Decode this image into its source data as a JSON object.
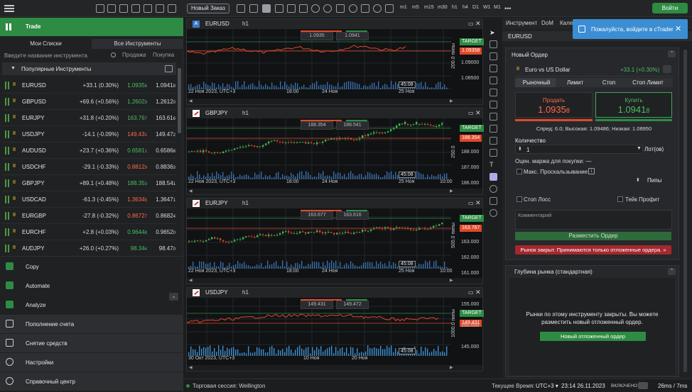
{
  "topbar": {
    "new_order_label": "Новый Заказ",
    "timeframes": [
      "m1",
      "m5",
      "m15",
      "m30",
      "h1",
      "h4",
      "D1",
      "W1",
      "M1"
    ],
    "login_label": "Войти"
  },
  "left": {
    "trade_title": "Trade",
    "tabs": [
      "Мои Списки",
      "Все Инструменты"
    ],
    "search_placeholder": "Введите название инструмента",
    "col_sell": "Продажа",
    "col_buy": "Покупка",
    "popular_title": "Популярные Инструменты",
    "instruments": [
      {
        "sym": "EURUSD",
        "chg": "+33.1 (0.30%)",
        "sell": "1.0935",
        "sell_sup": "8",
        "buy": "1.0941",
        "buy_sup": "8"
      },
      {
        "sym": "GBPUSD",
        "chg": "+69.6 (+0.56%)",
        "sell": "1.2602",
        "sell_sup": "9",
        "buy": "1.2612",
        "buy_sup": "0"
      },
      {
        "sym": "EURJPY",
        "chg": "+31.8 (+0.20%)",
        "sell": "163.76",
        "sell_sup": "7",
        "buy": "163.61",
        "buy_sup": "6"
      },
      {
        "sym": "USDJPY",
        "chg": "-14.1 (-0.09%)",
        "sell": "149.43",
        "sell_sup": "1",
        "buy": "149.47",
        "buy_sup": "2"
      },
      {
        "sym": "AUDUSD",
        "chg": "+23.7 (+0.36%)",
        "sell": "0.6581",
        "sell_sup": "1",
        "buy": "0.6586",
        "buy_sup": "8"
      },
      {
        "sym": "USDCHF",
        "chg": "-29.1 (-0.33%)",
        "sell": "0.8812",
        "sell_sup": "9",
        "buy": "0.8836",
        "buy_sup": "3"
      },
      {
        "sym": "GBPJPY",
        "chg": "+89.1 (+0.48%)",
        "sell": "188.35",
        "sell_sup": "3",
        "buy": "188.54",
        "buy_sup": "1"
      },
      {
        "sym": "USDCAD",
        "chg": "-61.3 (-0.45%)",
        "sell": "1.3634",
        "sell_sup": "5",
        "buy": "1.3647",
        "buy_sup": "1"
      },
      {
        "sym": "EURGBP",
        "chg": "-27.8 (-0.32%)",
        "sell": "0.8672",
        "sell_sup": "7",
        "buy": "0.8682",
        "buy_sup": "4"
      },
      {
        "sym": "EURCHF",
        "chg": "+2.8 (+0.03%)",
        "sell": "0.9644",
        "sell_sup": "8",
        "buy": "0.9652",
        "buy_sup": "0"
      },
      {
        "sym": "AUDJPY",
        "chg": "+26.0 (+0.27%)",
        "sell": "98.34",
        "sell_sup": "4",
        "buy": "98.47",
        "buy_sup": "0"
      }
    ],
    "menu": [
      "Copy",
      "Automate",
      "Analyze",
      "Пополнение счета",
      "Снятие средств",
      "Настройки",
      "Справочный центр"
    ]
  },
  "charts": [
    {
      "sym": "EURUSD",
      "tf": "h1",
      "target": "TARGET",
      "price": "1.09358",
      "y_labels": [
        "1.09000",
        "1.08500"
      ],
      "x_labels": [
        "22 Ноя 2023, UTC+3",
        "18:00",
        "24 Ноя",
        "25 Ноя"
      ],
      "time_box": "45:08",
      "pips_label": "200.0 пипы",
      "bid": "1.0935",
      "ask": "1.0941"
    },
    {
      "sym": "GBPJPY",
      "tf": "h1",
      "target": "TARGET",
      "price": "188.354",
      "y_labels": [
        "188.000",
        "187.000",
        "186.000"
      ],
      "x_labels": [
        "22 Ноя 2023, UTC+3",
        "18:00",
        "24 Ноя",
        "25 Ноя",
        "10:00"
      ],
      "time_box": "45:08",
      "pips_label": "250.0",
      "bid": "188.354",
      "ask": "188.541"
    },
    {
      "sym": "EURJPY",
      "tf": "h1",
      "target": "TARGET",
      "price": "163.767",
      "y_labels": [
        "163.000",
        "162.000",
        "161.000"
      ],
      "x_labels": [
        "22 Ноя 2023, UTC+3",
        "18:00",
        "24 Ноя",
        "25 Ноя",
        "10:00"
      ],
      "time_box": "45:08",
      "pips_label": "500.0 пипы",
      "bid": "163.677",
      "ask": "163.616"
    },
    {
      "sym": "USDJPY",
      "tf": "h1",
      "target": "TARGET",
      "price": "149.431",
      "y_labels": [
        "155.000",
        "150.000",
        "145.000"
      ],
      "x_labels": [
        "30 Окт 2023, UTC+3",
        "10 Ноя",
        "20 Ноя"
      ],
      "time_box": "45:08",
      "pips_label": "1000.0 пипы",
      "bid": "149.431",
      "ask": "149.472"
    }
  ],
  "right": {
    "tabs": [
      "Инструмент",
      "DoM",
      "Кале"
    ],
    "symbol": "EURUSD",
    "login_notice": "Пожалуйста, войдите в cTrader",
    "order_title": "Новый Ордер",
    "inst_name": "Euro vs US Dollar",
    "inst_chg": "+33.1 (+0.30%)",
    "order_types": [
      "Рыночный",
      "Лимит",
      "Стоп",
      "Стоп Лимит"
    ],
    "sell_label": "Продать",
    "sell_price": "1.0935",
    "sell_sup": "8",
    "buy_label": "Купить",
    "buy_price": "1.0941",
    "buy_sup": "8",
    "spread": "Спред: 6.0; Высокая: 1.09486; Низкая: 1.08950",
    "qty_label": "Количество",
    "qty_value": "1",
    "lots_label": "Лот(ов)",
    "margin_label": "Оцен. маржа для покупки: —",
    "slippage_label": "Макс. Проскальзывание",
    "pips_label": "Пипы",
    "stop_loss_label": "Стоп Лосс",
    "take_profit_label": "Тейк Профит",
    "comment_placeholder": "Комментарий",
    "place_order_label": "Разместить Ордер",
    "market_closed": "Рынок закрыт. Принимаются только отложенные ордера.  »",
    "dom_title": "Глубина рынка (стандартная)",
    "dom_msg_1": "Рынки по этому инструменту закрыты. Вы можете",
    "dom_msg_2": "разместить новый отложенный ордер.",
    "dom_btn": "Новый отложенный ордер"
  },
  "status": {
    "session": "Торговая сессия: Wellington",
    "cur_time_label": "Текущее Время:",
    "tz": "UTC+3 ▾",
    "clock": "23:14 26.11.2023",
    "enabled": "ВКЛЮЧЕНО",
    "latency": "26ms / 7ms"
  },
  "colors": {
    "accent_green": "#2e8b43",
    "sell_red": "#e0482a",
    "buy_green": "#4cbe63",
    "notice_blue": "#3b8ed3",
    "closed_red": "#a4282e"
  }
}
